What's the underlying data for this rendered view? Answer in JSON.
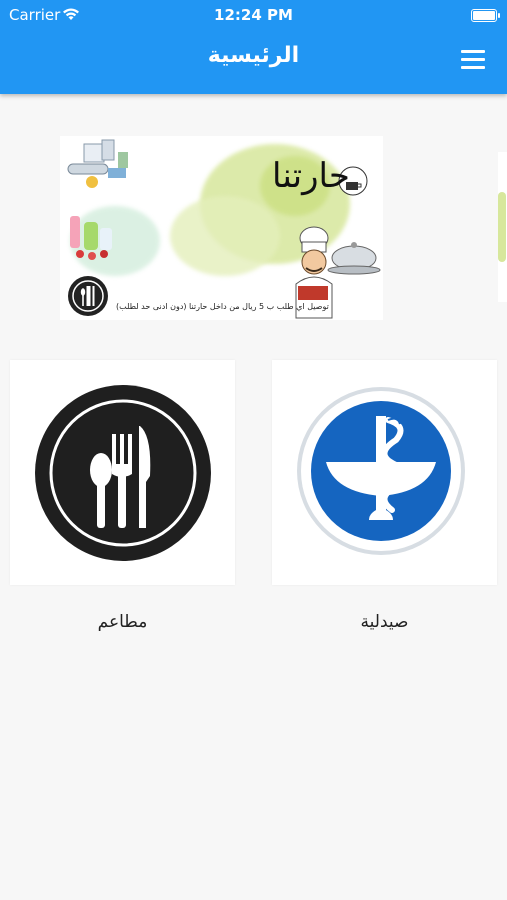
{
  "status_bar": {
    "carrier": "Carrier",
    "time": "12:24 PM"
  },
  "header": {
    "title": "الرئيسية",
    "menu_icon": "hamburger-menu-icon"
  },
  "banner": {
    "title": "حارتنا",
    "caption": "توصيل اي طلب ب 5 ريال من داخل حارتنا (دون ادنى حد لطلب)"
  },
  "categories": [
    {
      "label": "مطاعم",
      "icon": "restaurant-cutlery-icon"
    },
    {
      "label": "صيدلية",
      "icon": "pharmacy-snake-bowl-icon"
    }
  ],
  "colors": {
    "appbar": "#2196f3",
    "pharmacy_blue": "#1565c0",
    "restaurant_dark": "#1f1f1f"
  }
}
